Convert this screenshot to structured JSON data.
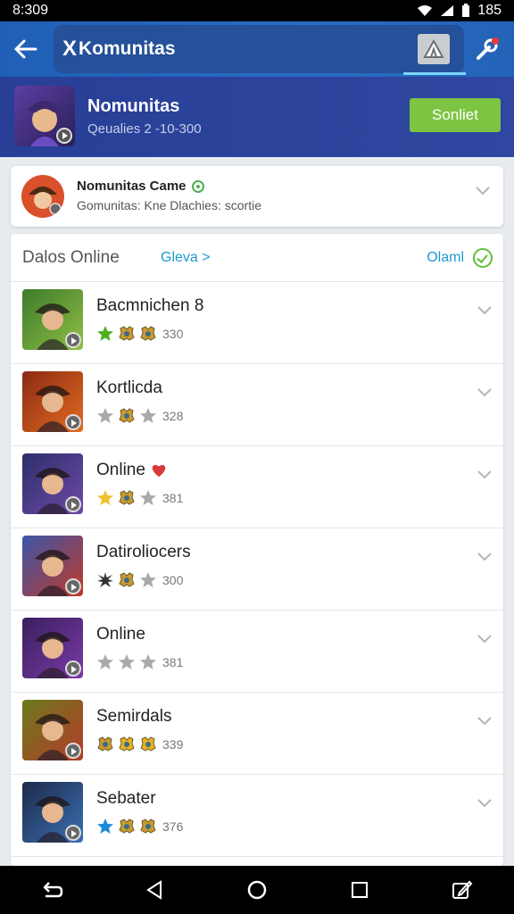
{
  "status_bar": {
    "time": "8:309",
    "battery_text": "185"
  },
  "app_bar": {
    "title": "Komunitas",
    "title_prefix": "X"
  },
  "header": {
    "title": "Nomunitas",
    "subtitle": "Qeualies 2 -10-300",
    "action_label": "Sonliet",
    "action_color": "#7cc442"
  },
  "game_card": {
    "title": "Nomunitas Came",
    "subtitle": "Gomunitas: Kne Dlachies: scortie"
  },
  "list": {
    "header_title": "Dalos Online",
    "header_link": "Gleva >",
    "header_status": "Olaml",
    "rows": [
      {
        "name": "Bacmnichen 8",
        "count": "330",
        "icons": [
          "star-green",
          "medal",
          "medal"
        ],
        "bg": [
          "#3d7a2c",
          "#8fbf43"
        ]
      },
      {
        "name": "Kortlicda",
        "count": "328",
        "icons": [
          "star-gray",
          "medal",
          "star-gray"
        ],
        "bg": [
          "#8a2a13",
          "#e26b21"
        ]
      },
      {
        "name": "Online",
        "count": "381",
        "icons": [
          "star-gold",
          "medal",
          "star-gray"
        ],
        "bg": [
          "#2d2f6a",
          "#6d4aa8"
        ],
        "heart": true
      },
      {
        "name": "Datiroliocers",
        "count": "300",
        "icons": [
          "spark",
          "medal",
          "star-gray"
        ],
        "bg": [
          "#3a56a8",
          "#c0392b"
        ]
      },
      {
        "name": "Online",
        "count": "381",
        "icons": [
          "star-gray",
          "star-gray",
          "star-gray"
        ],
        "bg": [
          "#3a1f5e",
          "#7a3aa8"
        ]
      },
      {
        "name": "Semirdals",
        "count": "339",
        "icons": [
          "medal",
          "medal-gold",
          "medal-gold"
        ],
        "bg": [
          "#6b7a1c",
          "#b63b2a"
        ]
      },
      {
        "name": "Sebater",
        "count": "376",
        "icons": [
          "star-blue",
          "medal",
          "medal"
        ],
        "bg": [
          "#1d2b4a",
          "#3b6fb3"
        ]
      }
    ]
  }
}
